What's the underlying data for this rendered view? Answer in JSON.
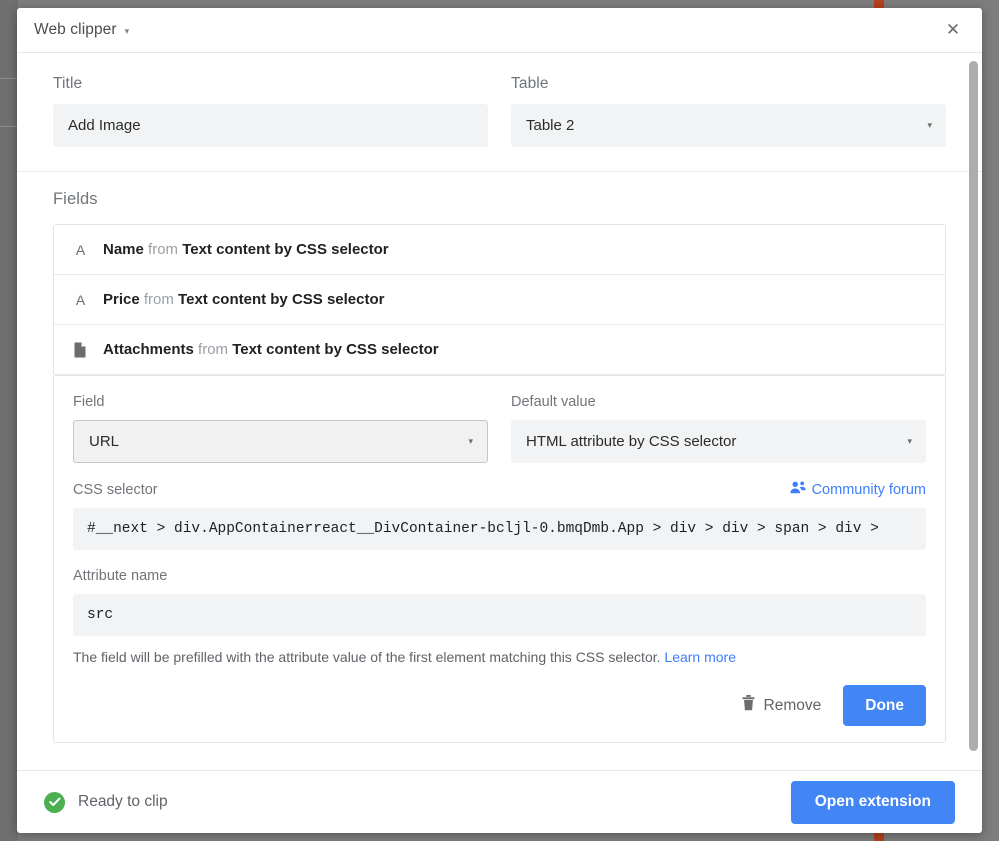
{
  "window": {
    "title": "Web clipper",
    "title_caret": "▾",
    "close_label": "✕"
  },
  "top": {
    "title_label": "Title",
    "title_value": "Add Image",
    "table_label": "Table",
    "table_value": "Table 2",
    "caret": "▾"
  },
  "fields": {
    "section_title": "Fields",
    "rows": [
      {
        "icon": "text-field-icon",
        "name": "Name",
        "from": "from",
        "source": "Text content by CSS selector"
      },
      {
        "icon": "text-field-icon",
        "name": "Price",
        "from": "from",
        "source": "Text content by CSS selector"
      },
      {
        "icon": "attachment-field-icon",
        "name": "Attachments",
        "from": "from",
        "source": "Text content by CSS selector"
      }
    ]
  },
  "detail": {
    "field_label": "Field",
    "field_value": "URL",
    "default_label": "Default value",
    "default_value": "HTML attribute by CSS selector",
    "css_selector_label": "CSS selector",
    "forum_link": "Community forum",
    "css_selector_value": "#__next > div.AppContainerreact__DivContainer-bcljl-0.bmqDmb.App > div > div > span > div >",
    "attribute_label": "Attribute name",
    "attribute_value": "src",
    "help_text": "The field will be prefilled with the attribute value of the first element matching this CSS selector.",
    "help_link": "Learn more",
    "remove_label": "Remove",
    "done_label": "Done",
    "caret": "▾"
  },
  "footer": {
    "status_text": "Ready to clip",
    "open_extension_label": "Open extension"
  },
  "colors": {
    "accent_blue": "#4285f4",
    "link_blue": "#3d7eff",
    "status_green": "#4caf50",
    "input_gray": "#f1f3f4",
    "backdrop_gray": "#7d7d7d",
    "red_mark": "#b5411f"
  }
}
